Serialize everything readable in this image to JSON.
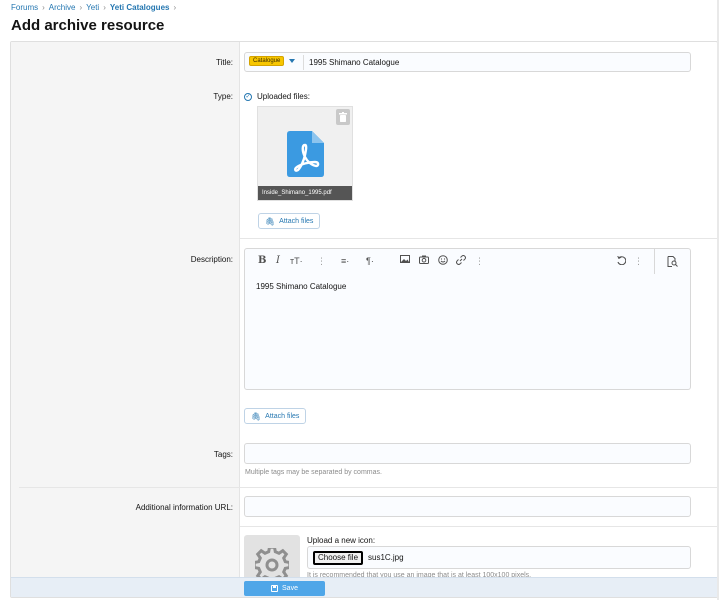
{
  "breadcrumb": {
    "items": [
      "Forums",
      "Archive",
      "Yeti",
      "Yeti Catalogues"
    ]
  },
  "page": {
    "title": "Add archive resource"
  },
  "form": {
    "title": {
      "label": "Title:",
      "prefix": "Catalogue",
      "value": "1995 Shimano Catalogue"
    },
    "type": {
      "label": "Type:",
      "option_label": "Uploaded files:",
      "file_name": "Inside_Shimano_1995.pdf",
      "attach_label": "Attach files"
    },
    "description": {
      "label": "Description:",
      "body": "1995 Shimano Catalogue",
      "attach_label": "Attach files",
      "toolbar": [
        "bold",
        "italic",
        "text-size",
        "more",
        "align",
        "paragraph-format",
        "image",
        "camera",
        "smilie",
        "link",
        "more",
        "undo",
        "more",
        "preview"
      ]
    },
    "tags": {
      "label": "Tags:",
      "value": "",
      "help": "Multiple tags may be separated by commas."
    },
    "url": {
      "label": "Additional information URL:",
      "value": ""
    },
    "icon": {
      "upload_label": "Upload a new icon:",
      "choose_label": "Choose file",
      "chosen_file": "sus1C.jpg",
      "help": "It is recommended that you use an image that is at least 100x100 pixels."
    }
  },
  "actions": {
    "save_label": "Save"
  },
  "colors": {
    "link": "#2577b1",
    "prefix_badge": "#f7c600",
    "save_button": "#4fa6e8",
    "submit_bar": "#e7eef6"
  }
}
